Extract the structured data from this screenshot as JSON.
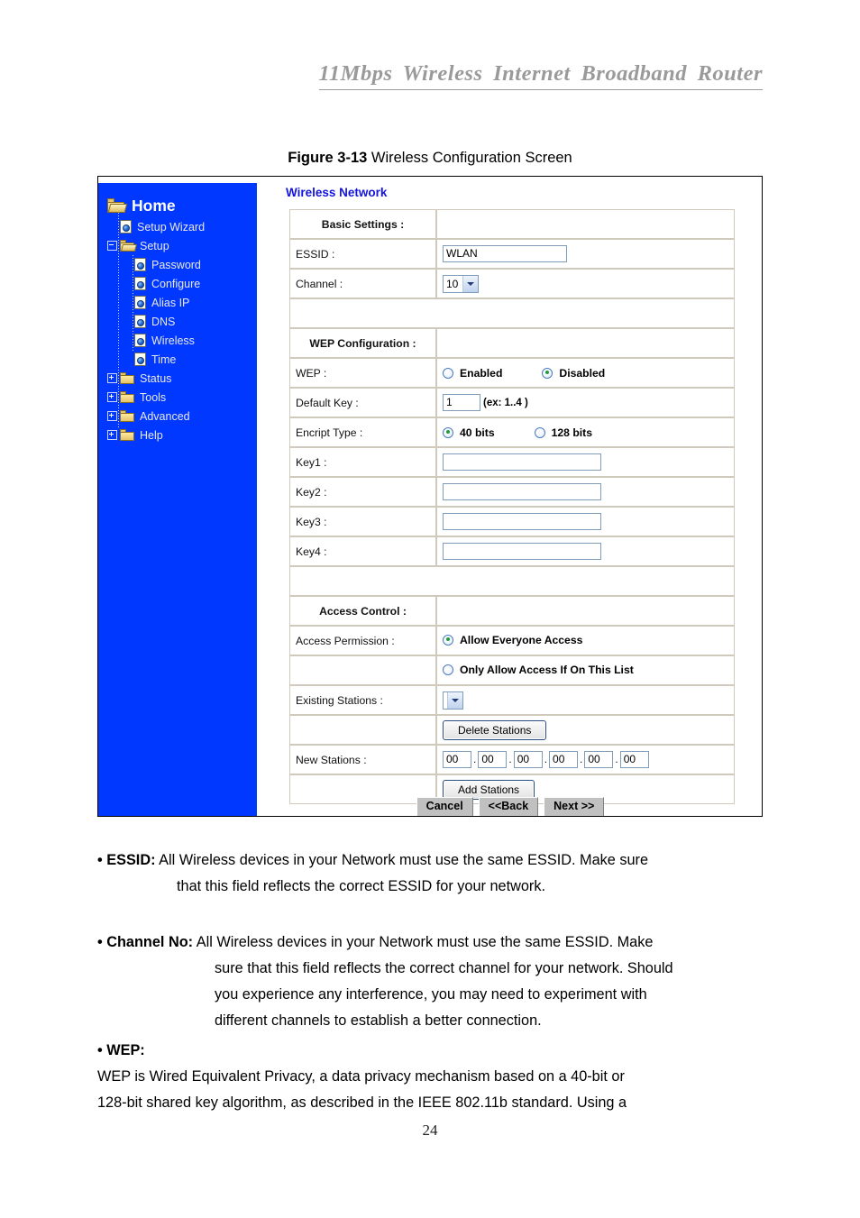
{
  "document": {
    "running_header": "11Mbps  Wireless  Internet  Broadband  Router",
    "figure_caption_label": "Figure 3-13",
    "figure_caption_text": " Wireless Configuration Screen",
    "page_number": "24"
  },
  "router_ui": {
    "panel_title": "Wireless Network",
    "sidebar": {
      "root": {
        "label": "Home",
        "icon": "folder-open-icon"
      },
      "items": [
        {
          "label": "Setup Wizard",
          "icon": "page-globe-icon",
          "indent": 1,
          "expander": "none"
        },
        {
          "label": "Setup",
          "icon": "folder-open-icon",
          "indent": 0,
          "expander": "minus"
        },
        {
          "label": "Password",
          "icon": "page-globe-icon",
          "indent": 2,
          "expander": "none"
        },
        {
          "label": "Configure",
          "icon": "page-globe-icon",
          "indent": 2,
          "expander": "none"
        },
        {
          "label": "Alias IP",
          "icon": "page-globe-icon",
          "indent": 2,
          "expander": "none"
        },
        {
          "label": "DNS",
          "icon": "page-globe-icon",
          "indent": 2,
          "expander": "none"
        },
        {
          "label": "Wireless",
          "icon": "page-globe-icon",
          "indent": 2,
          "expander": "none"
        },
        {
          "label": "Time",
          "icon": "page-globe-icon",
          "indent": 2,
          "expander": "none"
        },
        {
          "label": "Status",
          "icon": "folder-closed-icon",
          "indent": 0,
          "expander": "plus"
        },
        {
          "label": "Tools",
          "icon": "folder-closed-icon",
          "indent": 0,
          "expander": "plus"
        },
        {
          "label": "Advanced",
          "icon": "folder-closed-icon",
          "indent": 0,
          "expander": "plus"
        },
        {
          "label": "Help",
          "icon": "folder-closed-icon",
          "indent": 0,
          "expander": "plus"
        }
      ]
    },
    "sections": {
      "basic_settings": "Basic Settings :",
      "wep_configuration": "WEP Configuration :",
      "access_control": "Access Control :"
    },
    "labels": {
      "essid": "ESSID :",
      "channel": "Channel :",
      "wep": "WEP :",
      "default_key": "Default Key :",
      "encrypt_type": "Encript Type :",
      "key1": "Key1 :",
      "key2": "Key2 :",
      "key3": "Key3 :",
      "key4": "Key4 :",
      "access_permission": "Access Permission :",
      "existing_stations": "Existing Stations :",
      "new_stations": "New Stations :"
    },
    "values": {
      "essid": "WLAN",
      "channel": "10",
      "default_key": "1",
      "default_key_hint": "(ex: 1..4 )",
      "key1": "",
      "key2": "",
      "key3": "",
      "key4": "",
      "existing_stations": "",
      "new_stations": [
        "00",
        "00",
        "00",
        "00",
        "00",
        "00"
      ]
    },
    "radios": {
      "wep_enabled": {
        "label": "Enabled",
        "selected": false
      },
      "wep_disabled": {
        "label": "Disabled",
        "selected": true
      },
      "enc_40": {
        "label": "40 bits",
        "selected": true
      },
      "enc_128": {
        "label": "128 bits",
        "selected": false
      },
      "allow_everyone": {
        "label": "Allow Everyone Access",
        "selected": true
      },
      "only_allow_list": {
        "label": "Only Allow Access If On This List",
        "selected": false
      }
    },
    "buttons": {
      "delete_stations": "Delete Stations",
      "add_stations": "Add Stations",
      "cancel": "Cancel",
      "back": "<<Back",
      "next": "Next >>"
    },
    "colors": {
      "sidebar_bg": "#0038ff",
      "panel_title": "#1414dd",
      "radio_dot": "#1d9e3b",
      "input_border": "#7f9db9"
    }
  },
  "body_text": {
    "essid_term": "• ESSID:",
    "essid_line1": " All Wireless devices in your Network must use the same ESSID. Make sure",
    "essid_line2": "that this field reflects the correct ESSID for your network.",
    "channel_term": "• Channel No:",
    "channel_line1": " All Wireless devices in your Network must use the same ESSID. Make",
    "channel_line2": "sure that this field reflects the correct channel for your network. Should",
    "channel_line3": "you experience any interference, you may need to experiment with",
    "channel_line4": "different channels to establish a better connection.",
    "wep_term": "• WEP:",
    "wep_line1": "WEP is Wired Equivalent Privacy, a data privacy mechanism based on a 40-bit or",
    "wep_line2": "128-bit shared key algorithm, as described in the IEEE 802.11b standard. Using a"
  }
}
